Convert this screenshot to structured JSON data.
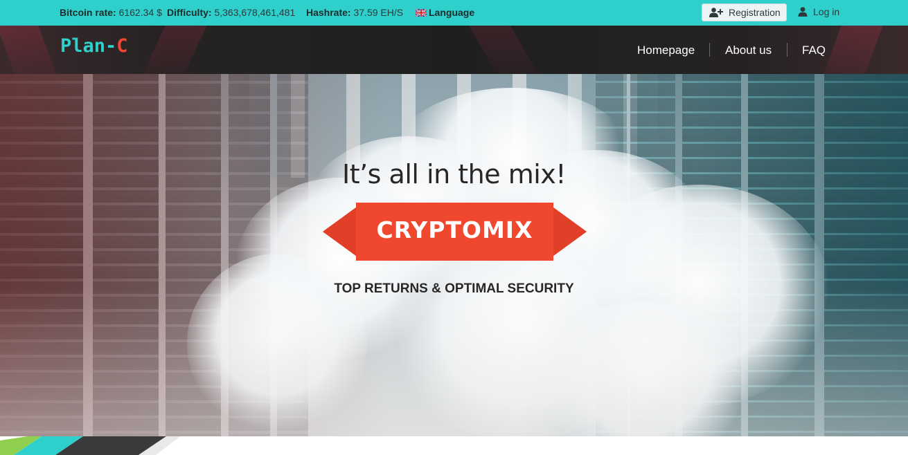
{
  "topbar": {
    "bitcoin_rate_label": "Bitcoin rate:",
    "bitcoin_rate_value": "6162.34 $",
    "difficulty_label": "Difficulty:",
    "difficulty_value": "5,363,678,461,481",
    "hashrate_label": "Hashrate:",
    "hashrate_value": "37.59 EH/S",
    "language_label": "Language",
    "language_icon": "uk-flag-icon",
    "registration_label": "Registration",
    "registration_icon": "user-plus-icon",
    "login_label": "Log in",
    "login_icon": "user-icon"
  },
  "header": {
    "logo_part1": "Plan-",
    "logo_part2": "C",
    "nav": [
      {
        "label": "Homepage"
      },
      {
        "label": "About us"
      },
      {
        "label": "FAQ"
      }
    ]
  },
  "hero": {
    "tagline": "It’s all in the mix!",
    "banner_text": "CRYPTOMIX",
    "subtitle": "TOP RETURNS & OPTIMAL SECURITY"
  },
  "colors": {
    "topbar_bg": "#2fcfcc",
    "accent_red": "#f0472f",
    "logo_teal": "#2fcfcc",
    "navbar_bg": "#1f1f20"
  }
}
